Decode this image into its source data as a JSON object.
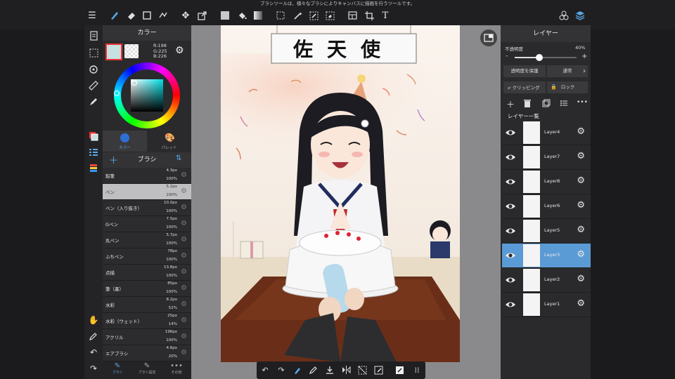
{
  "tooltip": "ブラシツールは、様々なブラシによりキャンバスに描画を行うツールです。",
  "toolbar": {
    "icons": [
      "menu-icon",
      "brush-icon",
      "eraser-icon",
      "rect-icon",
      "transform-icon",
      "move-icon",
      "resize-icon",
      "fill-color-icon",
      "bucket-icon",
      "gradient-icon",
      "select-icon",
      "magic-wand-icon",
      "select-pen-icon",
      "select-eraser-icon",
      "layout-icon",
      "crop-icon",
      "text-icon",
      "materials-icon",
      "layers-icon"
    ]
  },
  "color_panel": {
    "title": "カラー",
    "r": "R:198",
    "g": "G:225",
    "b": "B:226",
    "tab_color": "カラー",
    "tab_palette": "パレット",
    "primary_color": "#c6e1e2"
  },
  "brush_panel": {
    "title": "ブラシ",
    "brushes": [
      {
        "name": "鉛筆",
        "size": "4.3px",
        "opacity": "100%"
      },
      {
        "name": "ペン",
        "size": "5.2px",
        "opacity": "100%"
      },
      {
        "name": "ペン（入り抜き）",
        "size": "10.0px",
        "opacity": "100%"
      },
      {
        "name": "Gペン",
        "size": "7.5px",
        "opacity": "100%"
      },
      {
        "name": "丸ペン",
        "size": "5.7px",
        "opacity": "100%"
      },
      {
        "name": "ふちペン",
        "size": "78px",
        "opacity": "100%"
      },
      {
        "name": "点描",
        "size": "13.8px",
        "opacity": "100%"
      },
      {
        "name": "筆（墨）",
        "size": "85px",
        "opacity": "100%"
      },
      {
        "name": "水彩",
        "size": "8.2px",
        "opacity": "52%"
      },
      {
        "name": "水彩（ウェット）",
        "size": "25px",
        "opacity": "14%"
      },
      {
        "name": "アクリル",
        "size": "196px",
        "opacity": "100%"
      },
      {
        "name": "エアブラシ",
        "size": "4.6px",
        "opacity": "20%"
      }
    ],
    "selected_index": 1,
    "footer_brush": "ブラシ",
    "footer_settings": "ブラシ設定",
    "footer_other": "その他"
  },
  "canvas": {
    "sign_text": "佐天使"
  },
  "layer_panel": {
    "title": "レイヤー",
    "opacity_label": "不透明度",
    "opacity_value": "40%",
    "opacity_fraction": 0.4,
    "minus": "-",
    "plus": "+",
    "protect_alpha": "透明度を保護",
    "blend_mode": "通常",
    "clipping": "クリッピング",
    "lock": "ロック",
    "list_title": "レイヤー一覧",
    "layers": [
      "Layer4",
      "Layer7",
      "Layer8",
      "Layer6",
      "Layer5",
      "Layer3",
      "Layer2",
      "Layer1"
    ],
    "selected_index": 5
  },
  "colors": {
    "accent": "#5b9bd5",
    "selected_brush_bg": "#bfbfc2"
  }
}
